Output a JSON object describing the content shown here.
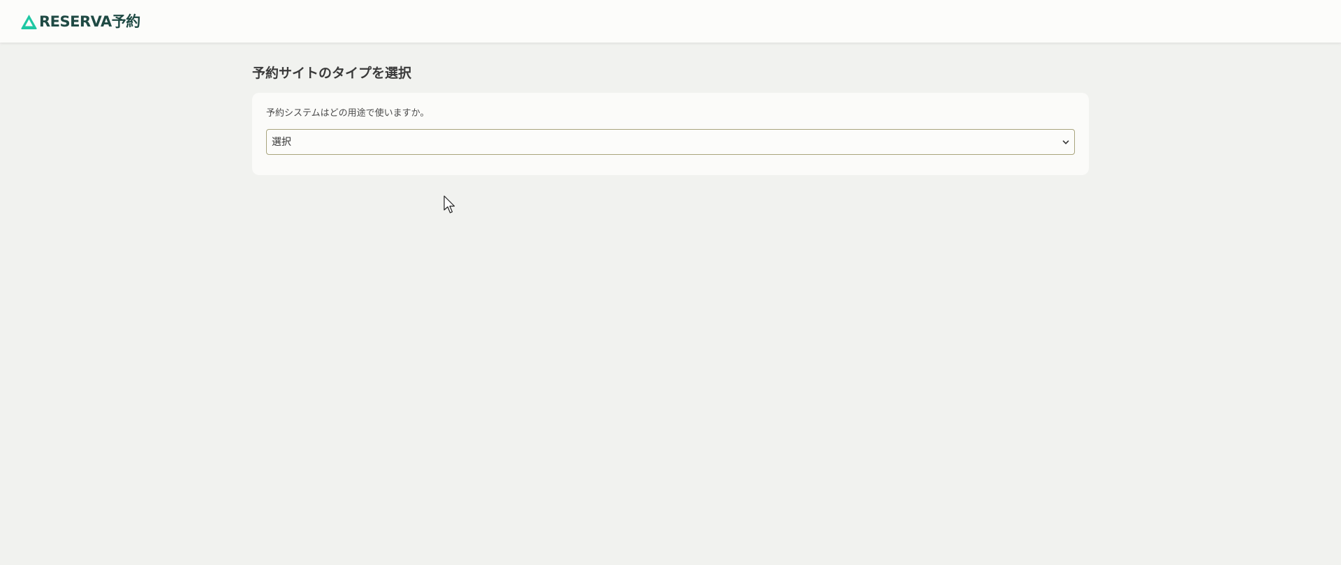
{
  "header": {
    "logo_text": "RESERVA予約",
    "logo_icon": "reserva-logo-icon",
    "brand_color": "#1fc7a3"
  },
  "main": {
    "title": "予約サイトのタイプを選択",
    "question": "予約システムはどの用途で使いますか。",
    "select": {
      "value": "選択",
      "icon": "chevron-down-icon"
    }
  }
}
